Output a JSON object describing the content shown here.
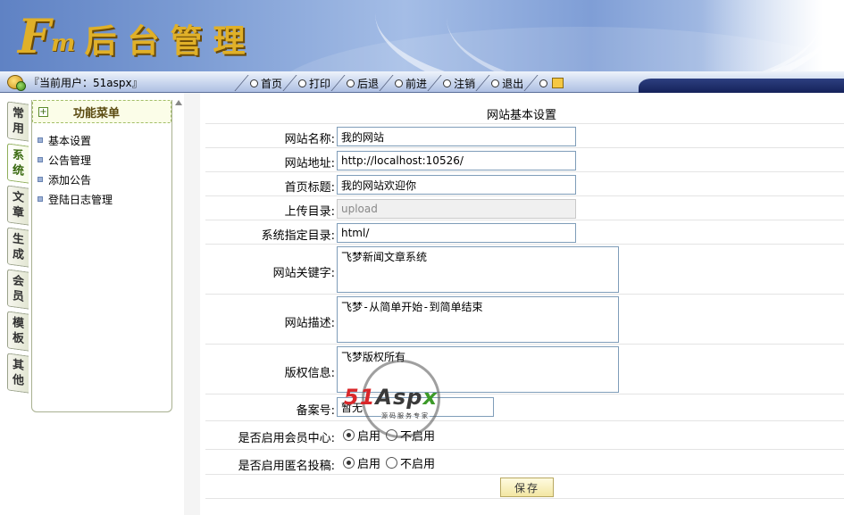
{
  "header": {
    "logo_mark": "F",
    "logo_sub": "m",
    "logo_text": "后台管理"
  },
  "navbar": {
    "user_info": "『当前用户：51aspx』",
    "items": [
      {
        "label": "首页"
      },
      {
        "label": "打印"
      },
      {
        "label": "后退"
      },
      {
        "label": "前进"
      },
      {
        "label": "注销"
      },
      {
        "label": "退出"
      }
    ],
    "last_icon": "folder-icon"
  },
  "vtabs": [
    {
      "chars": [
        "常",
        "用"
      ],
      "active": false
    },
    {
      "chars": [
        "系",
        "统"
      ],
      "active": true
    },
    {
      "chars": [
        "文",
        "章"
      ],
      "active": false
    },
    {
      "chars": [
        "生",
        "成"
      ],
      "active": false
    },
    {
      "chars": [
        "会",
        "员"
      ],
      "active": false
    },
    {
      "chars": [
        "模",
        "板"
      ],
      "active": false
    },
    {
      "chars": [
        "其",
        "他"
      ],
      "active": false
    }
  ],
  "menu": {
    "title": "功能菜单",
    "toggle": "+",
    "items": [
      {
        "label": "基本设置"
      },
      {
        "label": "公告管理"
      },
      {
        "label": "添加公告"
      },
      {
        "label": "登陆日志管理"
      }
    ]
  },
  "form": {
    "title": "网站基本设置",
    "site_name": {
      "label": "网站名称:",
      "value": "我的网站"
    },
    "site_url": {
      "label": "网站地址:",
      "value": "http://localhost:10526/"
    },
    "home_title": {
      "label": "首页标题:",
      "value": "我的网站欢迎你"
    },
    "upload_dir": {
      "label": "上传目录:",
      "value": "upload"
    },
    "system_dir": {
      "label": "系统指定目录:",
      "value": "html/"
    },
    "keywords": {
      "label": "网站关键字:",
      "value": "飞梦新闻文章系统"
    },
    "description": {
      "label": "网站描述:",
      "value": "飞梦-从简单开始-到简单结束"
    },
    "copyright": {
      "label": "版权信息:",
      "value": "飞梦版权所有"
    },
    "icp": {
      "label": "备案号:",
      "value": "暂无"
    },
    "member_center": {
      "label": "是否启用会员中心:",
      "on": "启用",
      "off": "不启用",
      "selected": "on"
    },
    "anonymous_post": {
      "label": "是否启用匿名投稿:",
      "on": "启用",
      "off": "不启用",
      "selected": "on"
    },
    "save_label": "保存"
  },
  "watermark": {
    "part1": "51",
    "part2": "Asp",
    "part3": "x",
    "sub": "源码服务专家"
  }
}
